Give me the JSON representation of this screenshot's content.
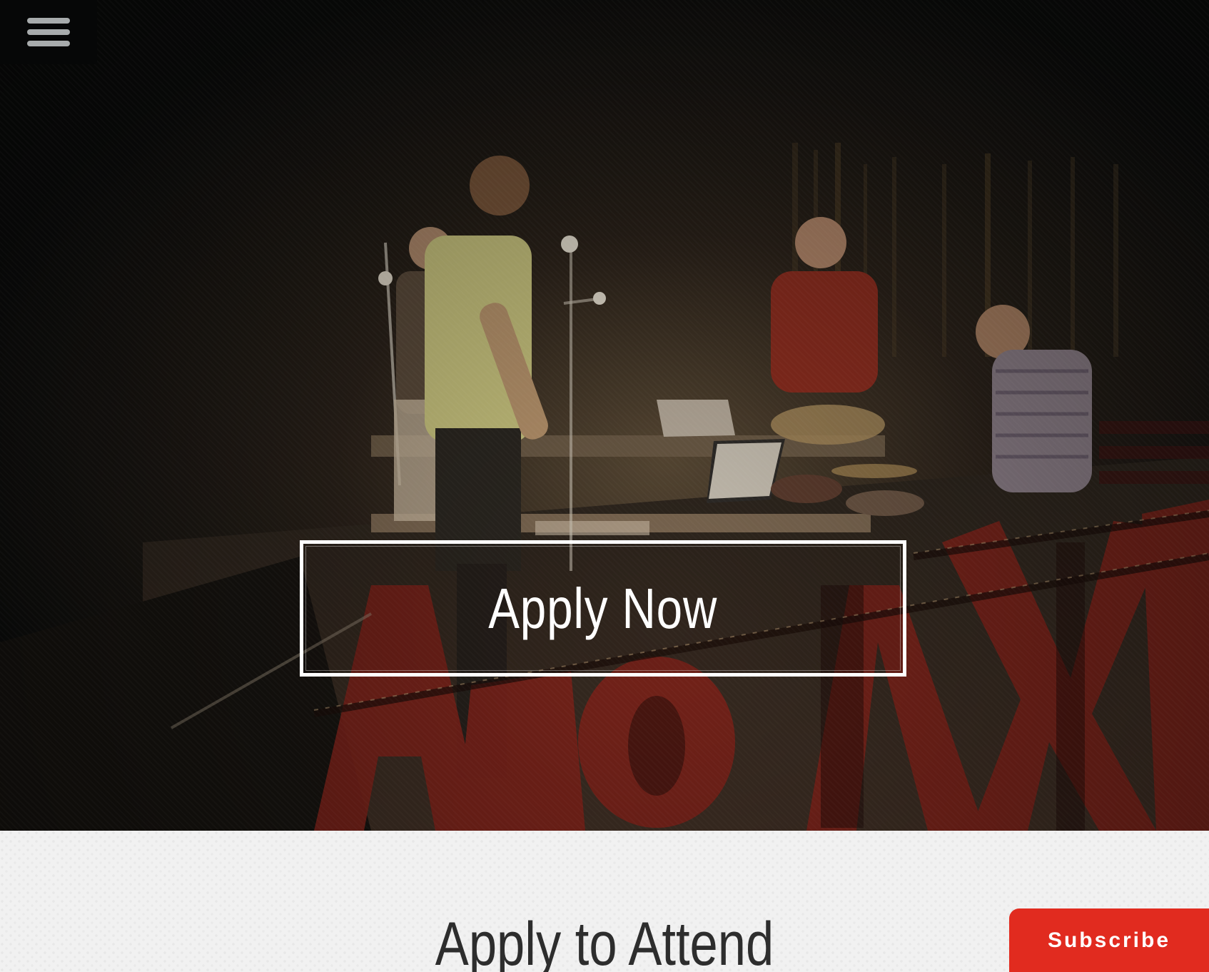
{
  "nav": {
    "menu_icon": "hamburger-menu-icon"
  },
  "hero": {
    "cta_label": "Apply Now"
  },
  "section": {
    "title": "Apply to Attend"
  },
  "subscribe": {
    "label": "Subscribe"
  },
  "colors": {
    "accent": "#e12b1f",
    "hero_overlay": "#0b0b0a",
    "menu_background": "#060707",
    "text_dark": "#2d2d2d"
  }
}
